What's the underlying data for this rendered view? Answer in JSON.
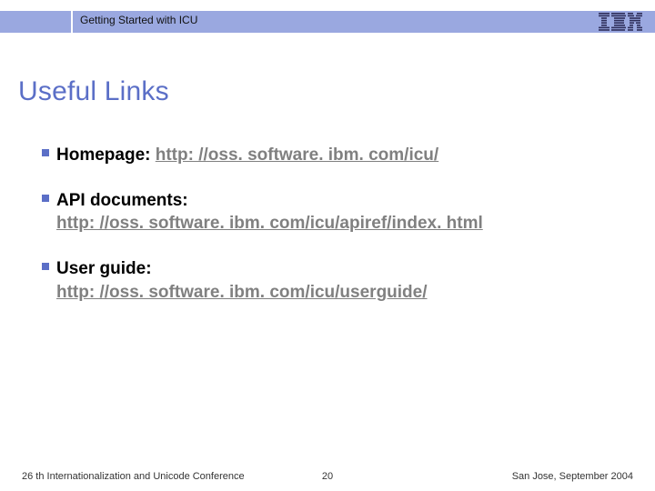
{
  "header": {
    "title": "Getting Started with ICU",
    "logo_name": "IBM"
  },
  "slide": {
    "title": "Useful Links"
  },
  "bullets": [
    {
      "label": "Homepage: ",
      "link": "http: //oss. software. ibm. com/icu/"
    },
    {
      "label": "API documents:",
      "link": "http: //oss. software. ibm. com/icu/apiref/index. html"
    },
    {
      "label": "User guide:",
      "link": "http: //oss. software. ibm. com/icu/userguide/"
    }
  ],
  "footer": {
    "left": "26 th Internationalization and Unicode Conference",
    "center": "20",
    "right": "San Jose, September 2004"
  }
}
